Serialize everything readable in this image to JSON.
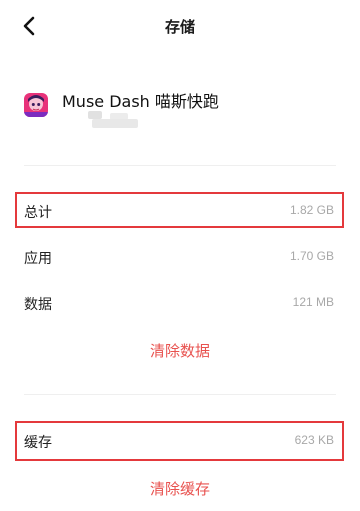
{
  "header": {
    "title": "存储"
  },
  "app": {
    "name": "Muse Dash 喵斯快跑",
    "icon": "muse-dash-app-icon"
  },
  "storage": {
    "total_label": "总计",
    "total_value": "1.82 GB",
    "app_label": "应用",
    "app_value": "1.70 GB",
    "data_label": "数据",
    "data_value": "121 MB",
    "clear_data_label": "清除数据",
    "cache_label": "缓存",
    "cache_value": "623 KB",
    "clear_cache_label": "清除缓存"
  },
  "colors": {
    "accent_red": "#e8524f",
    "highlight_border": "#e4393c",
    "secondary_text": "#a8a8a8"
  }
}
